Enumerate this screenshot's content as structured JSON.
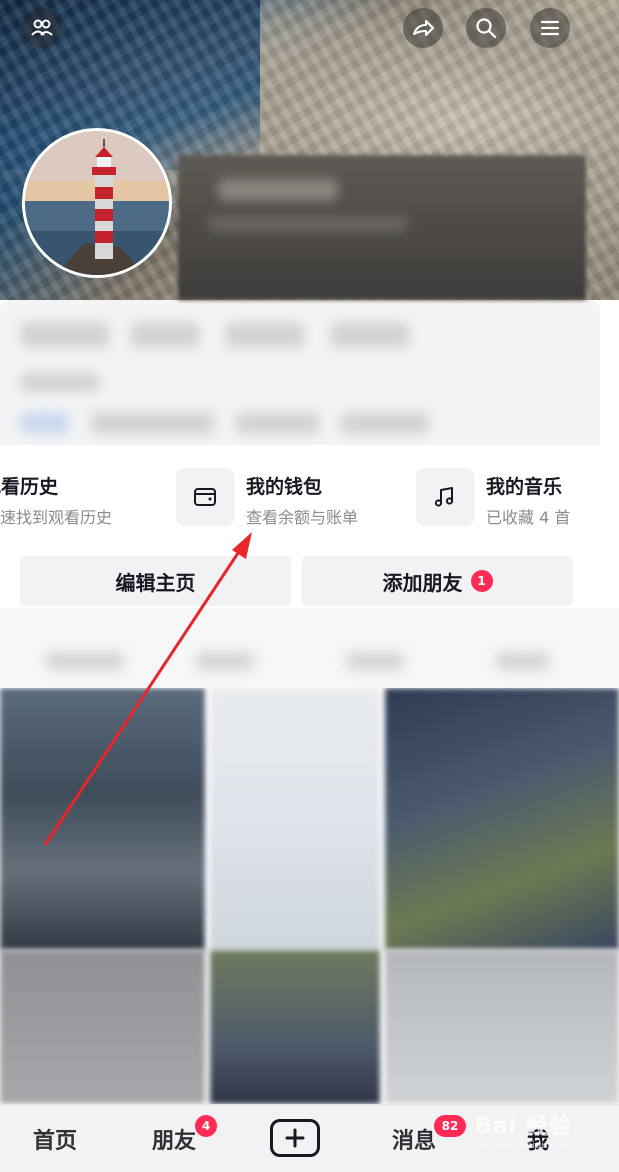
{
  "header": {
    "icons": [
      "friends-icon",
      "share-icon",
      "search-icon",
      "menu-icon"
    ]
  },
  "shortcuts": [
    {
      "title": "观看历史",
      "subtitle": "快速找到观看历史",
      "icon": "history-icon"
    },
    {
      "title": "我的钱包",
      "subtitle": "查看余额与账单",
      "icon": "wallet-icon"
    },
    {
      "title": "我的音乐",
      "subtitle": "已收藏 4 首",
      "icon": "music-note-icon"
    }
  ],
  "actions": {
    "edit_profile": "编辑主页",
    "add_friend": "添加朋友",
    "add_friend_badge": "1"
  },
  "bottom_nav": {
    "home": "首页",
    "friends": "朋友",
    "friends_badge": "4",
    "messages": "消息",
    "messages_badge": "82",
    "me": "我"
  },
  "watermark": {
    "text": "Bai 经验",
    "sub": "jingyan.baidu.com"
  },
  "colors": {
    "accent": "#fe2c55",
    "annotation_arrow": "#e8262a",
    "text_primary": "#161823",
    "text_secondary": "#8a8b91"
  }
}
